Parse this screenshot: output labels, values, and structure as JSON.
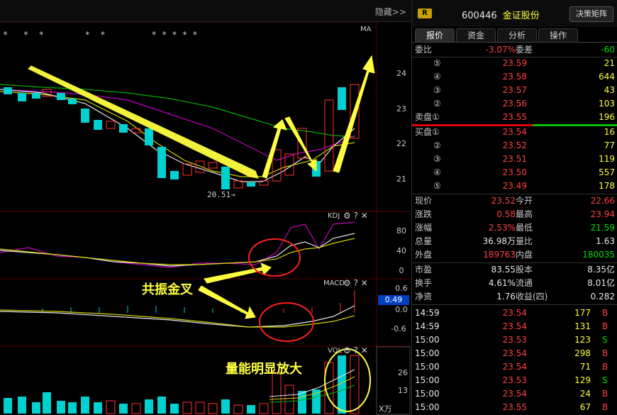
{
  "chart": {
    "hide_label": "隐藏>>",
    "ma_label": "MA",
    "price_axis": [
      "24",
      "23",
      "22",
      "21"
    ],
    "low_marker": "20.51→",
    "kdj_label": "KDJ",
    "kdj_axis": [
      "80",
      "40",
      "0"
    ],
    "macd_label": "MACD",
    "macd_axis": [
      "0.6",
      "0.0",
      "-0.6"
    ],
    "macd_value": "0.49",
    "vol_label": "VOL",
    "vol_axis": [
      "26",
      "13",
      "X万"
    ],
    "star_marks": "*   *  *        *  *         * * * * *",
    "annotation_resonance": "共振金叉",
    "annotation_volume": "量能明显放大"
  },
  "panel": {
    "badge": "R",
    "code": "600446",
    "name": "金证股份",
    "decision_button": "决策矩阵",
    "tabs": [
      "报价",
      "资金",
      "分析",
      "操作"
    ],
    "weibi_label": "委比",
    "weibi_value": "-3.07%",
    "weicha_label": "委差",
    "weicha_value": "-60",
    "asks": [
      {
        "label": "⑤",
        "price": "23.59",
        "vol": "21"
      },
      {
        "label": "④",
        "price": "23.58",
        "vol": "644"
      },
      {
        "label": "③",
        "price": "23.57",
        "vol": "43"
      },
      {
        "label": "②",
        "price": "23.56",
        "vol": "103"
      },
      {
        "label": "卖盘①",
        "price": "23.55",
        "vol": "196"
      }
    ],
    "bids": [
      {
        "label": "买盘①",
        "price": "23.54",
        "vol": "16"
      },
      {
        "label": "②",
        "price": "23.52",
        "vol": "77"
      },
      {
        "label": "③",
        "price": "23.51",
        "vol": "119"
      },
      {
        "label": "④",
        "price": "23.50",
        "vol": "557"
      },
      {
        "label": "⑤",
        "price": "23.49",
        "vol": "178"
      }
    ],
    "stats": [
      {
        "l1": "现价",
        "v1": "23.52",
        "c1": "red",
        "l2": "今开",
        "v2": "22.66",
        "c2": "red"
      },
      {
        "l1": "涨跌",
        "v1": "0.58",
        "c1": "red",
        "l2": "最高",
        "v2": "23.94",
        "c2": "red"
      },
      {
        "l1": "涨幅",
        "v1": "2.53%",
        "c1": "red",
        "l2": "最低",
        "v2": "21.59",
        "c2": "green"
      },
      {
        "l1": "总量",
        "v1": "36.98万",
        "c1": "white",
        "l2": "量比",
        "v2": "1.63",
        "c2": "white"
      },
      {
        "l1": "外盘",
        "v1": "189763",
        "c1": "red",
        "l2": "内盘",
        "v2": "180035",
        "c2": "green"
      }
    ],
    "stats2": [
      {
        "l1": "市盈",
        "v1": "83.55",
        "l2": "股本",
        "v2": "8.35亿"
      },
      {
        "l1": "换手",
        "v1": "4.61%",
        "l2": "流通",
        "v2": "8.01亿"
      },
      {
        "l1": "净资",
        "v1": "1.76",
        "l2": "收益(四)",
        "v2": "0.282"
      }
    ],
    "ticks": [
      {
        "time": "14:59",
        "price": "23.54",
        "vol": "177",
        "side": "B"
      },
      {
        "time": "14:59",
        "price": "23.54",
        "vol": "131",
        "side": "B"
      },
      {
        "time": "15:00",
        "price": "23.53",
        "vol": "123",
        "side": "S"
      },
      {
        "time": "15:00",
        "price": "23.54",
        "vol": "298",
        "side": "B"
      },
      {
        "time": "15:00",
        "price": "23.54",
        "vol": "71",
        "side": "B"
      },
      {
        "time": "15:00",
        "price": "23.53",
        "vol": "129",
        "side": "S"
      },
      {
        "time": "15:00",
        "price": "23.54",
        "vol": "24",
        "side": "B"
      },
      {
        "time": "15:00",
        "price": "23.55",
        "vol": "67",
        "side": "B"
      }
    ],
    "colors": {
      "up": "#ff4040",
      "down": "#00e000",
      "accent": "#ffff40"
    }
  }
}
